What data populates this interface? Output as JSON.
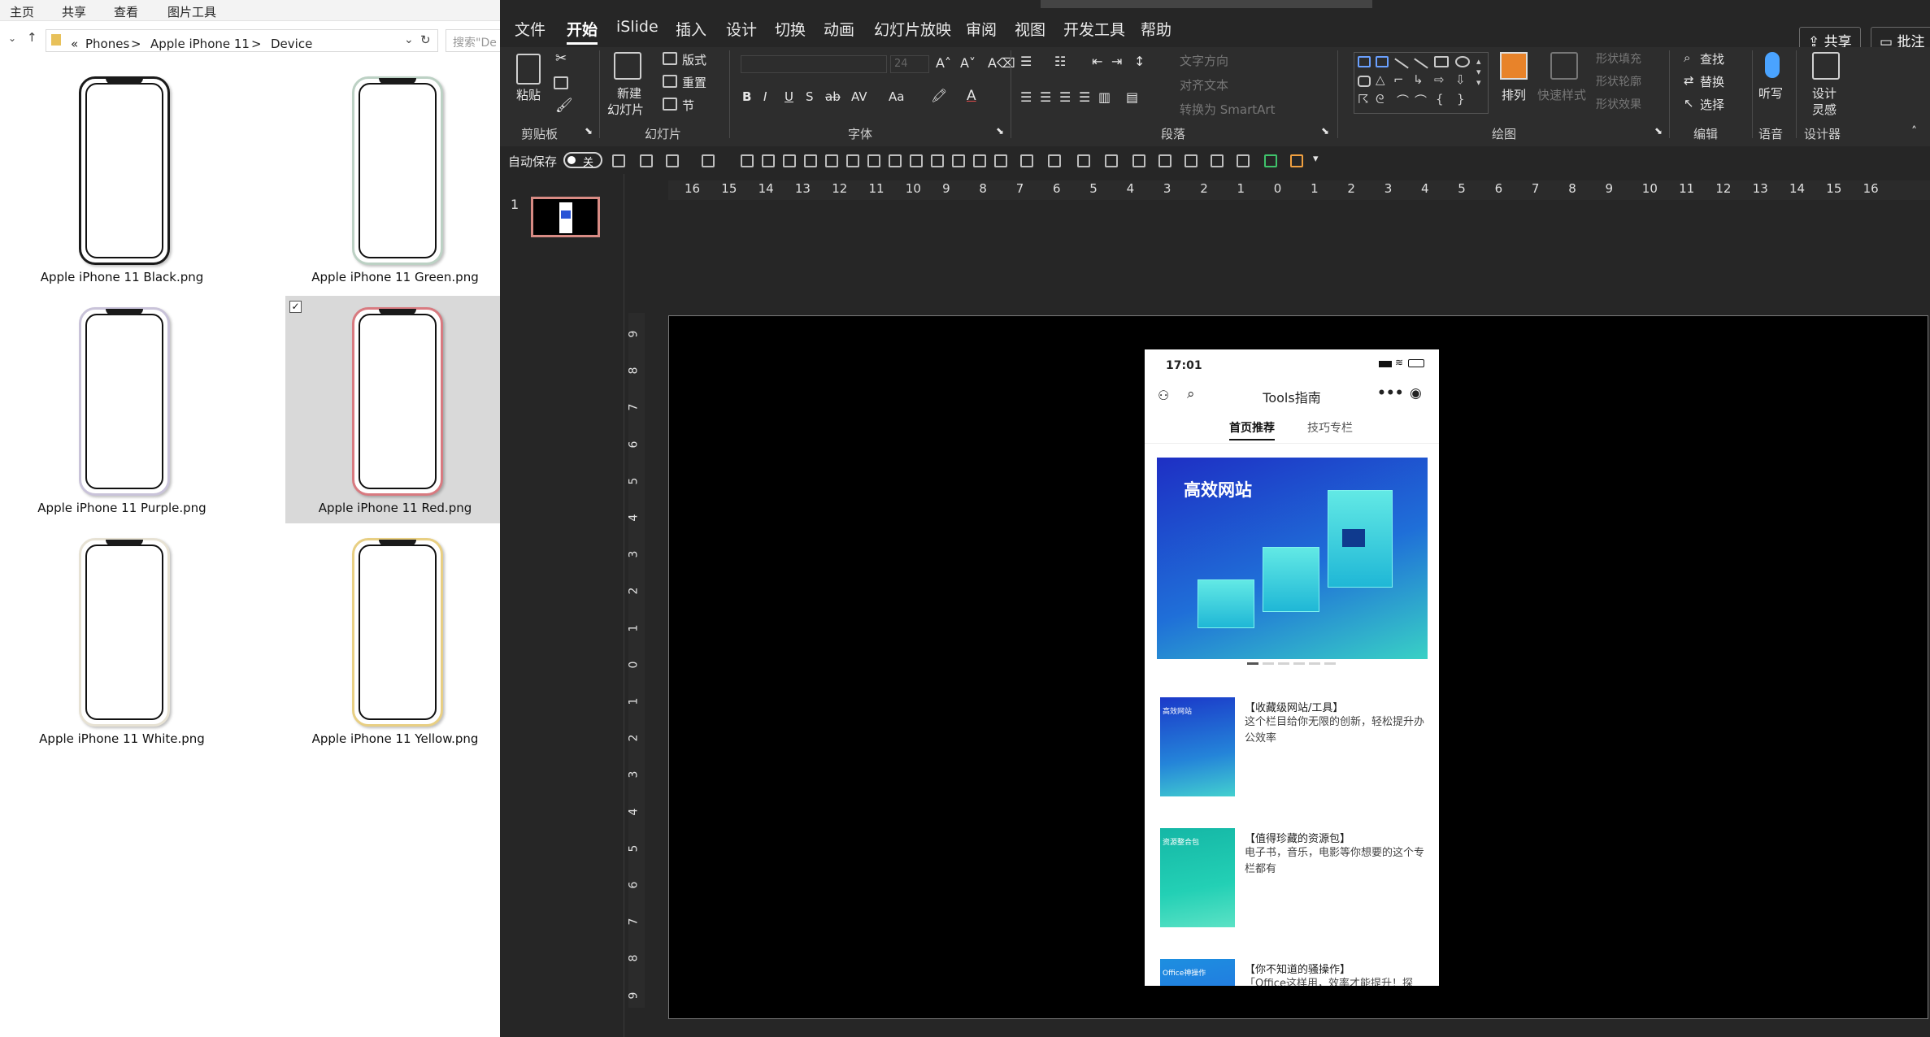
{
  "explorer": {
    "menu": [
      "主页",
      "共享",
      "查看",
      "图片工具"
    ],
    "breadcrumb": [
      "«",
      "Phones",
      ">",
      "Apple iPhone 11",
      ">",
      "Device"
    ],
    "search_placeholder": "搜索\"De",
    "files": [
      {
        "name": "Apple iPhone 11 Black.png",
        "frame_color": "#1a1a1a",
        "selected": false
      },
      {
        "name": "Apple iPhone 11 Green.png",
        "frame_color": "#bcd1c4",
        "selected": false
      },
      {
        "name": "Apple iPhone 11 Purple.png",
        "frame_color": "#c9c3d9",
        "selected": false
      },
      {
        "name": "Apple iPhone 11 Red.png",
        "frame_color": "#d87a80",
        "selected": true
      },
      {
        "name": "Apple iPhone 11 White.png",
        "frame_color": "#e7e2d4",
        "selected": false
      },
      {
        "name": "Apple iPhone 11 Yellow.png",
        "frame_color": "#e8cf83",
        "selected": false
      }
    ]
  },
  "ppt": {
    "tabs": [
      "文件",
      "开始",
      "iSlide",
      "插入",
      "设计",
      "切换",
      "动画",
      "幻灯片放映",
      "审阅",
      "视图",
      "开发工具",
      "帮助"
    ],
    "active_tab": "开始",
    "share_label": "共享",
    "comment_label": "批注",
    "groups": {
      "clipboard": {
        "label": "剪贴板",
        "paste": "粘贴"
      },
      "slides": {
        "label": "幻灯片",
        "new_slide_1": "新建",
        "new_slide_2": "幻灯片",
        "layout": "版式",
        "reset": "重置",
        "section": "节"
      },
      "font": {
        "label": "字体",
        "size": "24",
        "bold": "B",
        "italic": "I",
        "underline": "U",
        "shadow": "S",
        "strike": "ab",
        "spacing": "AV",
        "case": "Aa"
      },
      "paragraph": {
        "label": "段落",
        "text_dir": "文字方向",
        "align_text": "对齐文本",
        "smartart": "转换为 SmartArt"
      },
      "drawing": {
        "label": "绘图",
        "arrange": "排列",
        "quick_styles": "快速样式",
        "fill": "形状填充",
        "outline": "形状轮廓",
        "effects": "形状效果"
      },
      "editing": {
        "label": "编辑",
        "find": "查找",
        "replace": "替换",
        "select": "选择"
      },
      "voice": {
        "label": "语音",
        "dictate": "听写"
      },
      "designer": {
        "label": "设计器",
        "ideas_1": "设计",
        "ideas_2": "灵感"
      }
    },
    "autosave_label": "自动保存",
    "autosave_state": "关",
    "slide_number": "1",
    "hruler": [
      "16",
      "15",
      "14",
      "13",
      "12",
      "11",
      "10",
      "9",
      "8",
      "7",
      "6",
      "5",
      "4",
      "3",
      "2",
      "1",
      "0",
      "1",
      "2",
      "3",
      "4",
      "5",
      "6",
      "7",
      "8",
      "9",
      "10",
      "11",
      "12",
      "13",
      "14",
      "15",
      "16"
    ],
    "vruler": [
      "9",
      "8",
      "7",
      "6",
      "5",
      "4",
      "3",
      "2",
      "1",
      "0",
      "1",
      "2",
      "3",
      "4",
      "5",
      "6",
      "7",
      "8",
      "9"
    ]
  },
  "mobile": {
    "time": "17:01",
    "title": "Tools指南",
    "tabs": [
      "首页推荐",
      "技巧专栏"
    ],
    "banner_title": "高效网站",
    "items": [
      {
        "title": "【收藏级网站/工具】",
        "desc": "这个栏目给你无限的创新，轻松提升办公效率",
        "thumb_label": "高效网站"
      },
      {
        "title": "【值得珍藏的资源包】",
        "desc": "电子书，音乐，电影等你想要的这个专栏都有",
        "thumb_label": "资源整合包"
      },
      {
        "title": "【你不知道的骚操作】",
        "desc": "「Office这样用，效率才能提升！探",
        "thumb_label": "Office神操作"
      }
    ]
  }
}
